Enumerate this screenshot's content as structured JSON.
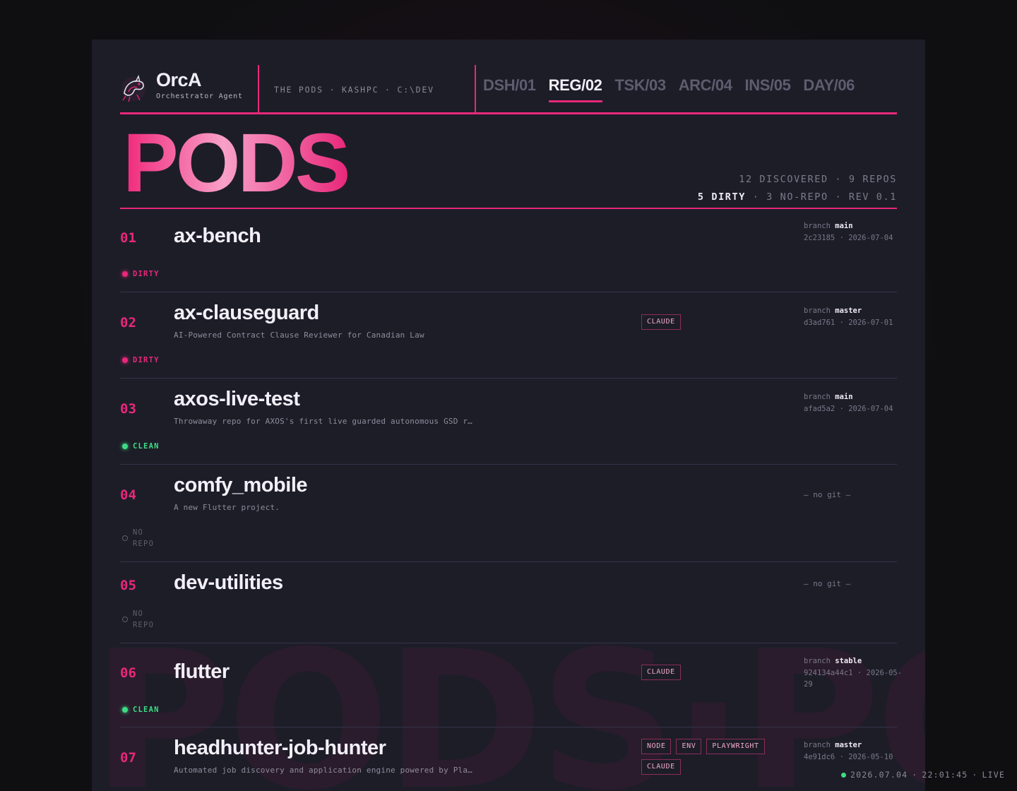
{
  "brand": {
    "name": "OrcA",
    "subtitle": "Orchestrator Agent",
    "logo_icon": "orca-logo-icon"
  },
  "breadcrumb": "THE PODS · KASHPC · C:\\DEV",
  "tabs": [
    {
      "label": "DSH/01",
      "active": false
    },
    {
      "label": "REG/02",
      "active": true
    },
    {
      "label": "TSK/03",
      "active": false
    },
    {
      "label": "ARC/04",
      "active": false
    },
    {
      "label": "INS/05",
      "active": false
    },
    {
      "label": "DAY/06",
      "active": false
    }
  ],
  "hero": {
    "title": "PODS",
    "stats_line1": "12 DISCOVERED · 9 REPOS",
    "dirty_count": "5 DIRTY",
    "stats_line2_rest": " · 3 NO-REPO · REV 0.1"
  },
  "watermark": "PODS·PODS",
  "colors": {
    "accent": "#e8287a",
    "clean": "#3ddc84",
    "background": "#1d1d28"
  },
  "pods": [
    {
      "num": "01",
      "name": "ax-bench",
      "desc": "",
      "status": "DIRTY",
      "tags": [],
      "branch_label": "branch",
      "branch": "main",
      "commit": "2c23185 · 2026-07-04"
    },
    {
      "num": "02",
      "name": "ax-clauseguard",
      "desc": "AI-Powered Contract Clause Reviewer for Canadian Law",
      "status": "DIRTY",
      "tags": [
        "CLAUDE"
      ],
      "branch_label": "branch",
      "branch": "master",
      "commit": "d3ad761 · 2026-07-01"
    },
    {
      "num": "03",
      "name": "axos-live-test",
      "desc": "Throwaway repo for AXOS's first live guarded autonomous GSD r…",
      "status": "CLEAN",
      "tags": [],
      "branch_label": "branch",
      "branch": "main",
      "commit": "afad5a2 · 2026-07-04"
    },
    {
      "num": "04",
      "name": "comfy_mobile",
      "desc": "A new Flutter project.",
      "status": "NO REPO",
      "tags": [],
      "nogit": "— no git —"
    },
    {
      "num": "05",
      "name": "dev-utilities",
      "desc": "",
      "status": "NO REPO",
      "tags": [],
      "nogit": "— no git —"
    },
    {
      "num": "06",
      "name": "flutter",
      "desc": "",
      "status": "CLEAN",
      "tags": [
        "CLAUDE"
      ],
      "branch_label": "branch",
      "branch": "stable",
      "commit": "924134a44c1 · 2026-05-29"
    },
    {
      "num": "07",
      "name": "headhunter-job-hunter",
      "desc": "Automated job discovery and application engine powered by Pla…",
      "status": "",
      "tags": [
        "NODE",
        "ENV",
        "PLAYWRIGHT",
        "CLAUDE"
      ],
      "branch_label": "branch",
      "branch": "master",
      "commit": "4e91dc6 · 2026-05-10"
    }
  ],
  "footer": {
    "date": "2026.07.04",
    "time": "22:01:45",
    "live_label": "LIVE"
  }
}
